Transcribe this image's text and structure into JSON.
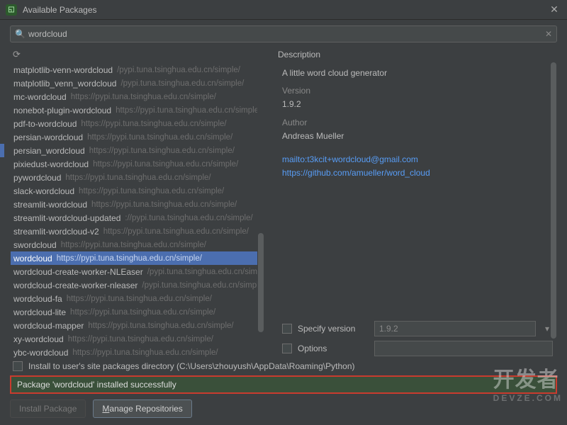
{
  "window": {
    "title": "Available Packages"
  },
  "search": {
    "value": "wordcloud"
  },
  "packages": {
    "repo": "https://pypi.tuna.tsinghua.edu.cn/simple/",
    "repo_short": "/pypi.tuna.tsinghua.edu.cn/simple/",
    "repo_shorter": "://pypi.tuna.tsinghua.edu.cn/simple/",
    "items": [
      "matplotlib-venn-wordcloud",
      "matplotlib_venn_wordcloud",
      "mc-wordcloud",
      "nonebot-plugin-wordcloud",
      "pdf-to-wordcloud",
      "persian-wordcloud",
      "persian_wordcloud",
      "pixiedust-wordcloud",
      "pywordcloud",
      "slack-wordcloud",
      "streamlit-wordcloud",
      "streamlit-wordcloud-updated",
      "streamlit-wordcloud-v2",
      "swordcloud",
      "wordcloud",
      "wordcloud-create-worker-NLEaser",
      "wordcloud-create-worker-nleaser",
      "wordcloud-fa",
      "wordcloud-lite",
      "wordcloud-mapper",
      "xy-wordcloud",
      "ybc-wordcloud"
    ],
    "selected_index": 14
  },
  "description": {
    "heading": "Description",
    "summary": "A little word cloud generator",
    "version_label": "Version",
    "version": "1.9.2",
    "author_label": "Author",
    "author": "Andreas Mueller",
    "mail": "mailto:t3kcit+wordcloud@gmail.com",
    "url": "https://github.com/amueller/word_cloud"
  },
  "options": {
    "specify_version_label": "Specify version",
    "specify_version_value": "1.9.2",
    "options_label": "Options",
    "options_value": ""
  },
  "site": {
    "label_prefix": "Install to user's site packages directory (",
    "path": "C:\\Users\\zhouyush\\AppData\\Roaming\\Python",
    "label_suffix": ")"
  },
  "status": {
    "message": "Package 'wordcloud' installed successfully"
  },
  "buttons": {
    "install": "Install Package",
    "manage_pre": "M",
    "manage_rest": "anage Repositories"
  },
  "watermark": {
    "main": "开发者",
    "sub": "DEVZE.COM"
  }
}
